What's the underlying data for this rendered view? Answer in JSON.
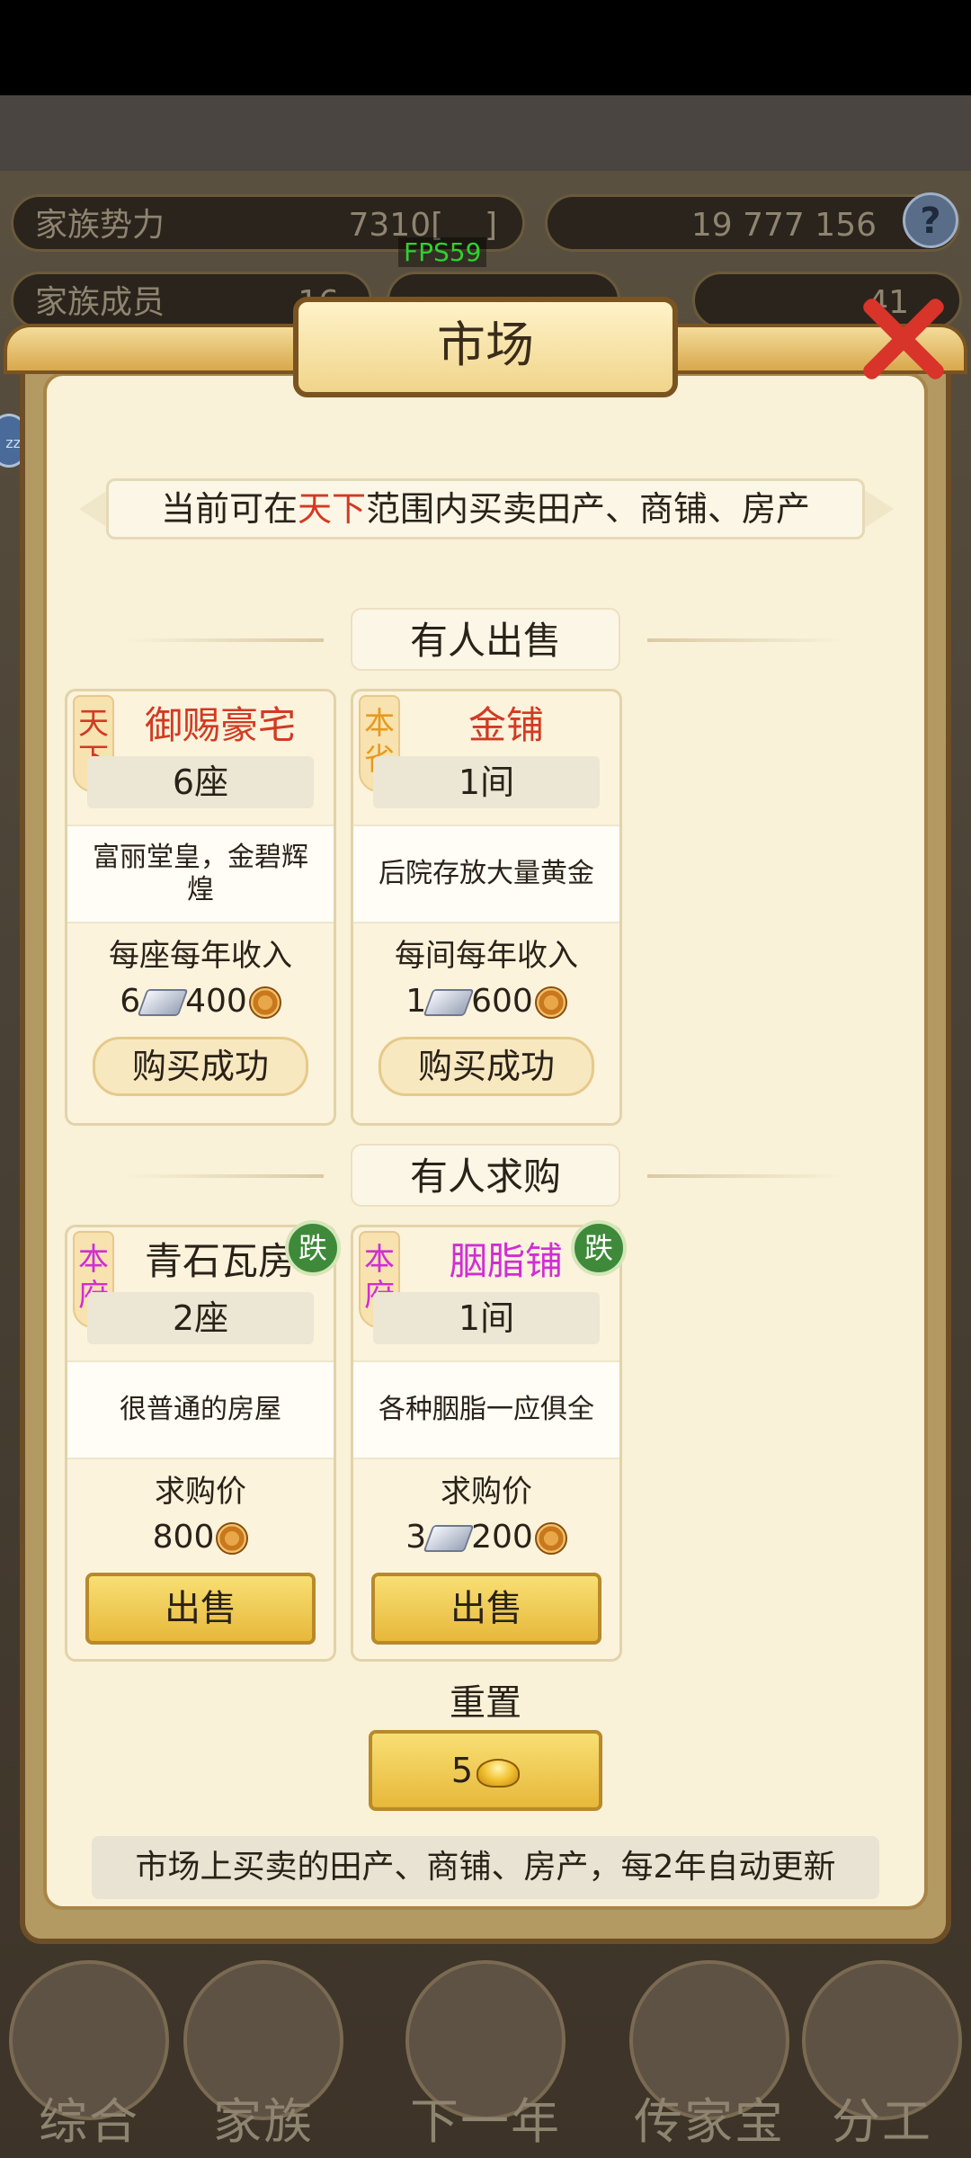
{
  "hud": {
    "family_power_label": "家族势力",
    "family_power_value": "7310[",
    "family_power_suffix": "]",
    "resources": "19 777 156",
    "family_members_label": "家族成员",
    "family_members_value": "16",
    "gold_value": "41",
    "fps": "FPS59"
  },
  "dialog": {
    "title": "市场",
    "notice_prefix": "当前可在",
    "notice_highlight": "天下",
    "notice_suffix": "范围内买卖田产、商铺、房产",
    "sell_section_title": "有人出售",
    "buy_section_title": "有人求购",
    "reset_label": "重置",
    "reset_cost": "5",
    "footer_note": "市场上买卖的田产、商铺、房产，每2年自动更新"
  },
  "for_sale": [
    {
      "region": "天下",
      "name": "御赐豪宅",
      "quantity": "6座",
      "description": "富丽堂皇，金碧辉煌",
      "income_label": "每座每年收入",
      "income_silver": "6",
      "income_coins": "400",
      "button": "购买成功"
    },
    {
      "region": "本省",
      "name": "金铺",
      "quantity": "1间",
      "description": "后院存放大量黄金",
      "income_label": "每间每年收入",
      "income_silver": "1",
      "income_coins": "600",
      "button": "购买成功"
    }
  ],
  "wanted": [
    {
      "region": "本府",
      "name": "青石瓦房",
      "quantity": "2座",
      "description": "很普通的房屋",
      "price_label": "求购价",
      "price_coins": "800",
      "badge": "跌",
      "button": "出售"
    },
    {
      "region": "本府",
      "name": "胭脂铺",
      "quantity": "1间",
      "description": "各种胭脂一应俱全",
      "price_label": "求购价",
      "price_silver": "3",
      "price_coins": "200",
      "badge": "跌",
      "button": "出售"
    }
  ],
  "bottom_nav": [
    "综合",
    "家族",
    "下一年",
    "传家宝",
    "分工"
  ],
  "colors": {
    "accent_red": "#d23a22",
    "region_orange": "#e79a1c",
    "rare_magenta": "#d12dd6",
    "gold_button": "#e7b83a",
    "badge_green": "#3e8a3a"
  }
}
